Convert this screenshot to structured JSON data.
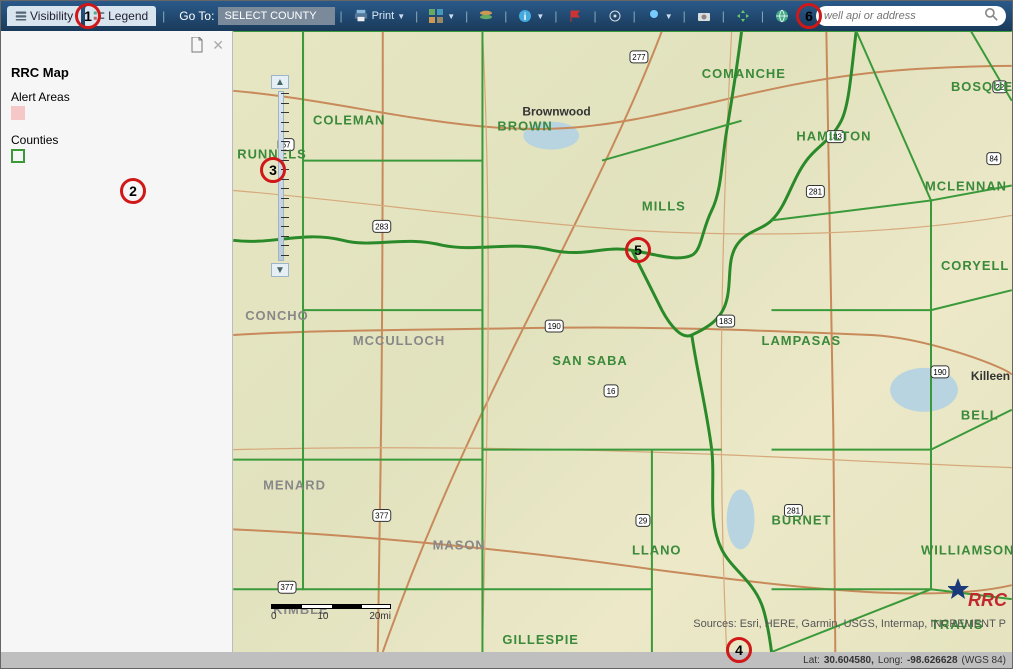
{
  "toolbar": {
    "tab_visibility": "Visibility",
    "tab_legend": "Legend",
    "go_to": "Go To:",
    "county_select": "SELECT COUNTY",
    "print": "Print"
  },
  "icons": {
    "visibility": "visibility-icon",
    "legend": "legend-icon",
    "print": "print-icon",
    "grid": "grid-icon",
    "layers": "layers-icon",
    "info": "info-icon",
    "flag": "flag-icon",
    "target": "target-icon",
    "highlight": "highlight-icon",
    "camera": "camera-icon",
    "pan": "pan-icon",
    "globe": "globe-icon",
    "search": "search-icon",
    "pdf": "pdf-icon",
    "close": "close-icon"
  },
  "search": {
    "placeholder": "well api or address"
  },
  "legend": {
    "title": "RRC Map",
    "alert_label": "Alert Areas",
    "counties_label": "Counties"
  },
  "markers": {
    "m1": "1",
    "m2": "2",
    "m3": "3",
    "m4": "4",
    "m5": "5",
    "m6": "6"
  },
  "counties": [
    "COMANCHE",
    "BOSQUE",
    "COLEMAN",
    "BROWN",
    "HAMILTON",
    "RUNNELS",
    "MCLENNAN",
    "MILLS",
    "CORYELL",
    "CONCHO",
    "MCCULLOCH",
    "SAN SABA",
    "LAMPASAS",
    "BELL",
    "MENARD",
    "BURNET",
    "MASON",
    "LLANO",
    "WILLIAMSON",
    "KIMBLE",
    "GILLESPIE",
    "TRAVIS"
  ],
  "towns": {
    "brownwood": "Brownwood",
    "killeen": "Killeen"
  },
  "scale": {
    "t0": "0",
    "t1": "10",
    "t2": "20mi"
  },
  "attribution": "Sources: Esri, HERE, Garmin, USGS, Intermap, INCREMENT P",
  "footer": {
    "lat_label": "Lat:",
    "lat": "30.604580,",
    "lon_label": "Long:",
    "lon": "-98.626628",
    "datum": "(WGS 84)"
  },
  "shields": [
    "277",
    "67",
    "183",
    "281",
    "22",
    "377",
    "283",
    "190",
    "183",
    "16",
    "190",
    "84",
    "377",
    "29",
    "281"
  ]
}
